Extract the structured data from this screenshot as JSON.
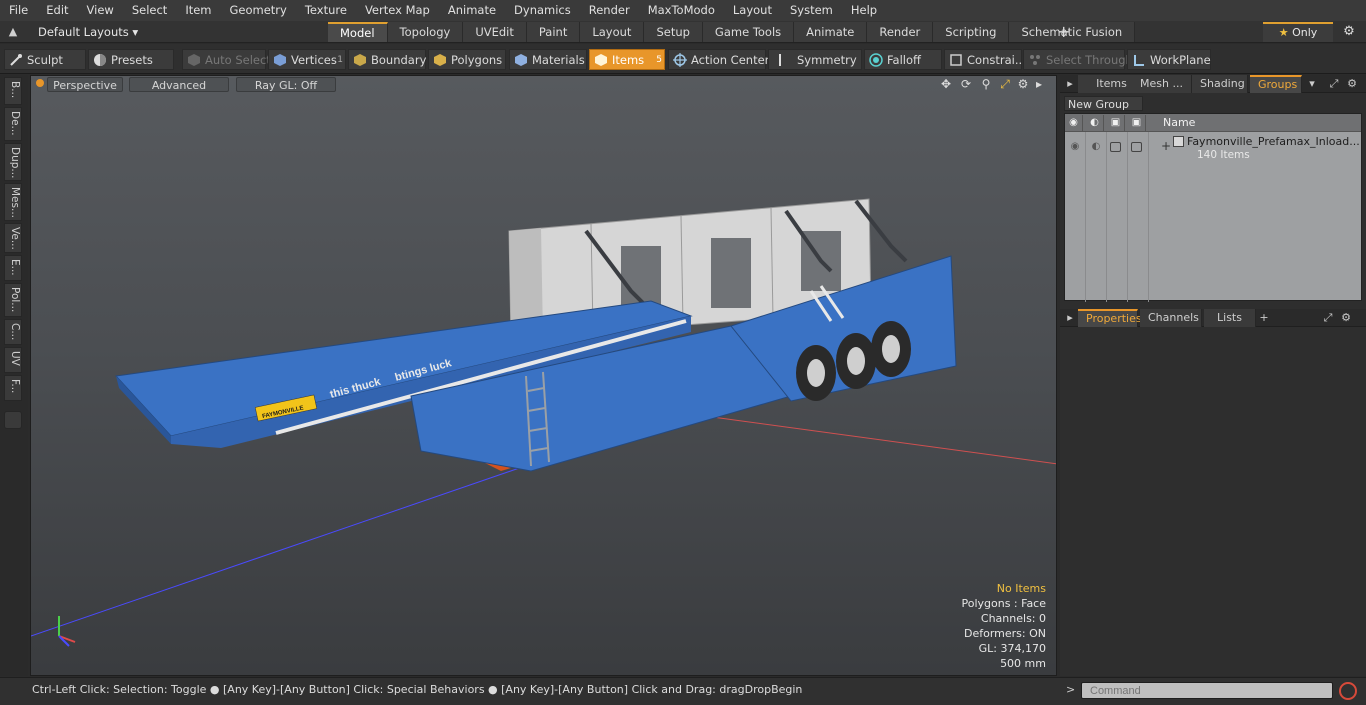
{
  "menu": [
    "File",
    "Edit",
    "View",
    "Select",
    "Item",
    "Geometry",
    "Texture",
    "Vertex Map",
    "Animate",
    "Dynamics",
    "Render",
    "MaxToModo",
    "Layout",
    "System",
    "Help"
  ],
  "layout_bar": {
    "layouts_label": "Default Layouts",
    "tabs": [
      "Model",
      "Topology",
      "UVEdit",
      "Paint",
      "Layout",
      "Setup",
      "Game Tools",
      "Animate",
      "Render",
      "Scripting",
      "Schematic Fusion"
    ],
    "active_tab": "Model",
    "only_label": "Only"
  },
  "toolbar": {
    "sculpt": "Sculpt",
    "presets": "Presets",
    "auto_select": "Auto Select",
    "vertices": "Vertices",
    "vertices_count": "1",
    "boundary": "Boundary",
    "polygons": "Polygons",
    "materials": "Materials",
    "items": "Items",
    "items_count": "5",
    "action_center": "Action Center",
    "symmetry": "Symmetry",
    "falloff": "Falloff",
    "constraints": "Constrai...",
    "select_through": "Select Through",
    "workplane": "WorkPlane"
  },
  "left_tabs": [
    "B...",
    "De...",
    "Dup...",
    "Mes...",
    "Ve...",
    "E...",
    "Pol...",
    "C...",
    "UV",
    "F..."
  ],
  "viewport": {
    "perspective": "Perspective",
    "advanced": "Advanced",
    "raygl": "Ray GL: Off",
    "info": {
      "selection": "No Items",
      "polygons": "Polygons : Face",
      "channels": "Channels: 0",
      "deformers": "Deformers: ON",
      "gl": "GL: 374,170",
      "scale": "500 mm"
    },
    "trailer_text_1": "this thuck",
    "trailer_text_2": "btings luck",
    "brand_label": "FAYMONVILLE"
  },
  "right_panel": {
    "top_tabs": [
      "Items",
      "Mesh ...",
      "Shading",
      "Groups"
    ],
    "active_top_tab": "Groups",
    "new_group": "New Group",
    "column_name": "Name",
    "group_name": "Faymonville_Prefamax_Inload...",
    "group_count": "140 Items",
    "bottom_tabs": [
      "Properties",
      "Channels",
      "Lists"
    ],
    "active_bottom_tab": "Properties"
  },
  "statusbar": {
    "message": "Ctrl-Left Click: Selection: Toggle ●  [Any Key]-[Any Button] Click: Special Behaviors ●  [Any Key]-[Any Button] Click and Drag: dragDropBegin",
    "command_placeholder": "Command"
  },
  "colors": {
    "accent": "#e8962a",
    "trailer_blue": "#3a72c4",
    "concrete": "#d8d8d8"
  }
}
